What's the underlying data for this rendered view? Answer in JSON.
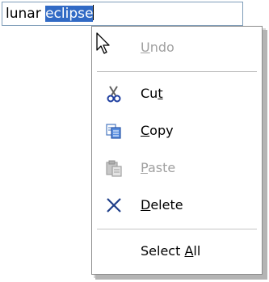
{
  "textbox": {
    "plain": "lunar ",
    "selected": "eclipse"
  },
  "menu": {
    "undo": {
      "pre": "",
      "mn": "U",
      "post": "ndo"
    },
    "cut": {
      "pre": "Cu",
      "mn": "t",
      "post": ""
    },
    "copy": {
      "pre": "",
      "mn": "C",
      "post": "opy"
    },
    "paste": {
      "pre": "",
      "mn": "P",
      "post": "aste"
    },
    "delete": {
      "pre": "",
      "mn": "D",
      "post": "elete"
    },
    "selectall": {
      "pre": "Select ",
      "mn": "A",
      "post": "ll"
    }
  },
  "icons": {
    "undo": "undo-icon",
    "cut": "scissors-icon",
    "copy": "copy-icon",
    "paste": "paste-icon",
    "delete": "delete-x-icon",
    "cursor": "mouse-pointer-icon"
  },
  "colors": {
    "selection": "#316ac5",
    "disabled_text": "#a0a0a0"
  }
}
